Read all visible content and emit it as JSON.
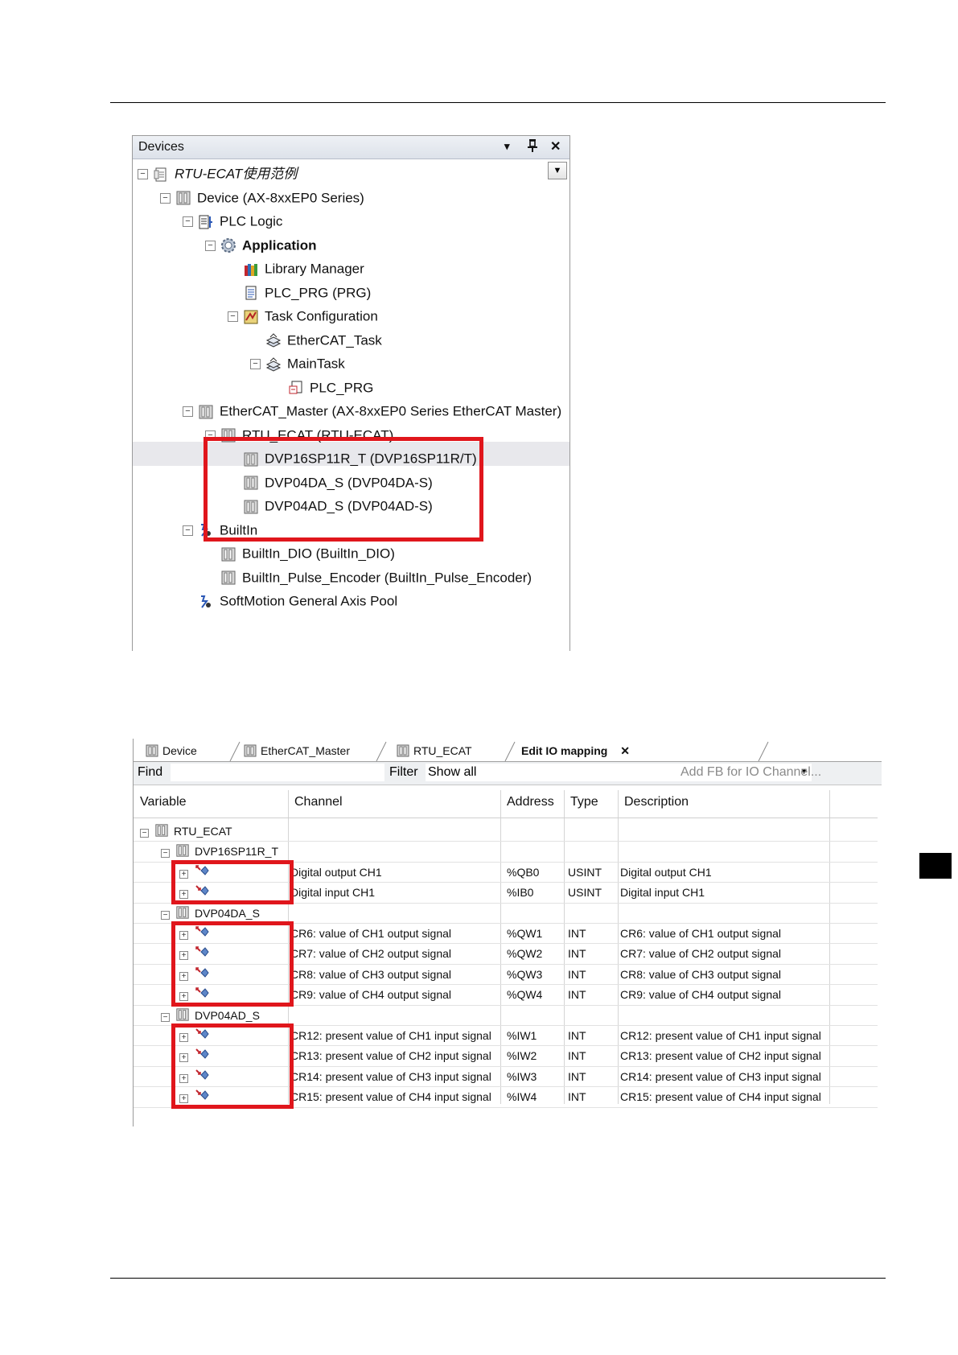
{
  "devices_panel": {
    "title": "Devices",
    "controls": {
      "dropdown": "▾",
      "pin": "📌",
      "close": "✕"
    },
    "tree": [
      {
        "label": "RTU-ECAT使用范例",
        "icon": "project-icon",
        "expand": "−",
        "italic": true
      },
      {
        "label": "Device (AX-8xxEP0 Series)",
        "icon": "device-icon",
        "expand": "−"
      },
      {
        "label": "PLC Logic",
        "icon": "plc-logic-icon",
        "expand": "−"
      },
      {
        "label": "Application",
        "icon": "application-gear-icon",
        "expand": "−",
        "bold": true
      },
      {
        "label": "Library Manager",
        "icon": "library-icon"
      },
      {
        "label": "PLC_PRG (PRG)",
        "icon": "program-icon"
      },
      {
        "label": "Task Configuration",
        "icon": "task-config-icon",
        "expand": "−"
      },
      {
        "label": "EtherCAT_Task",
        "icon": "task-icon"
      },
      {
        "label": "MainTask",
        "icon": "task-icon",
        "expand": "−"
      },
      {
        "label": "PLC_PRG",
        "icon": "program-call-icon"
      },
      {
        "label": "EtherCAT_Master (AX-8xxEP0 Series EtherCAT Master)",
        "icon": "device-icon",
        "expand": "−"
      },
      {
        "label": "RTU_ECAT (RTU-ECAT)",
        "icon": "device-icon",
        "expand": "−"
      },
      {
        "label": "DVP16SP11R_T (DVP16SP11R/T)",
        "icon": "device-icon"
      },
      {
        "label": "DVP04DA_S (DVP04DA-S)",
        "icon": "device-icon"
      },
      {
        "label": "DVP04AD_S (DVP04AD-S)",
        "icon": "device-icon"
      },
      {
        "label": "BuiltIn",
        "icon": "builtin-icon",
        "expand": "−"
      },
      {
        "label": "BuiltIn_DIO (BuiltIn_DIO)",
        "icon": "device-icon"
      },
      {
        "label": "BuiltIn_Pulse_Encoder (BuiltIn_Pulse_Encoder)",
        "icon": "device-icon"
      },
      {
        "label": "SoftMotion General Axis Pool",
        "icon": "axis-pool-icon"
      }
    ]
  },
  "io_panel": {
    "tabs": [
      {
        "label": "Device",
        "active": false
      },
      {
        "label": "EtherCAT_Master",
        "active": false
      },
      {
        "label": "RTU_ECAT",
        "active": false
      },
      {
        "label": "Edit IO mapping",
        "active": true
      }
    ],
    "tab_close": "✕",
    "filter_bar": {
      "find_label": "Find",
      "filter_label": "Filter",
      "filter_value": "Show all",
      "add_fb_label": "Add FB for IO Channel..."
    },
    "columns": [
      "Variable",
      "Channel",
      "Address",
      "Type",
      "Description"
    ],
    "rows": [
      {
        "kind": "root",
        "variable": "RTU_ECAT"
      },
      {
        "kind": "device",
        "variable": "DVP16SP11R_T"
      },
      {
        "kind": "io-out",
        "channel": "Digital output CH1",
        "address": "%QB0",
        "type": "USINT",
        "description": "Digital output CH1"
      },
      {
        "kind": "io-in",
        "channel": "Digital input CH1",
        "address": "%IB0",
        "type": "USINT",
        "description": "Digital input CH1"
      },
      {
        "kind": "device",
        "variable": "DVP04DA_S"
      },
      {
        "kind": "io-out",
        "channel": "CR6: value of CH1 output signal",
        "address": "%QW1",
        "type": "INT",
        "description": "CR6: value of CH1 output signal"
      },
      {
        "kind": "io-out",
        "channel": "CR7: value of CH2 output signal",
        "address": "%QW2",
        "type": "INT",
        "description": "CR7: value of CH2 output signal"
      },
      {
        "kind": "io-out",
        "channel": "CR8: value of CH3 output signal",
        "address": "%QW3",
        "type": "INT",
        "description": "CR8: value of CH3 output signal"
      },
      {
        "kind": "io-out",
        "channel": "CR9: value of CH4 output signal",
        "address": "%QW4",
        "type": "INT",
        "description": "CR9: value of CH4 output signal"
      },
      {
        "kind": "device",
        "variable": "DVP04AD_S"
      },
      {
        "kind": "io-in",
        "channel": "CR12: present value of CH1 input signal",
        "address": "%IW1",
        "type": "INT",
        "description": "CR12: present value of CH1 input signal"
      },
      {
        "kind": "io-in",
        "channel": "CR13: present value of CH2 input signal",
        "address": "%IW2",
        "type": "INT",
        "description": "CR13: present value of CH2 input signal"
      },
      {
        "kind": "io-in",
        "channel": "CR14: present value of CH3 input signal",
        "address": "%IW3",
        "type": "INT",
        "description": "CR14: present value of CH3 input signal"
      },
      {
        "kind": "io-in",
        "channel": "CR15: present value of CH4 input signal",
        "address": "%IW4",
        "type": "INT",
        "description": "CR15: present value of CH4 input signal"
      }
    ]
  },
  "colors": {
    "highlight_box": "#e0161c"
  }
}
